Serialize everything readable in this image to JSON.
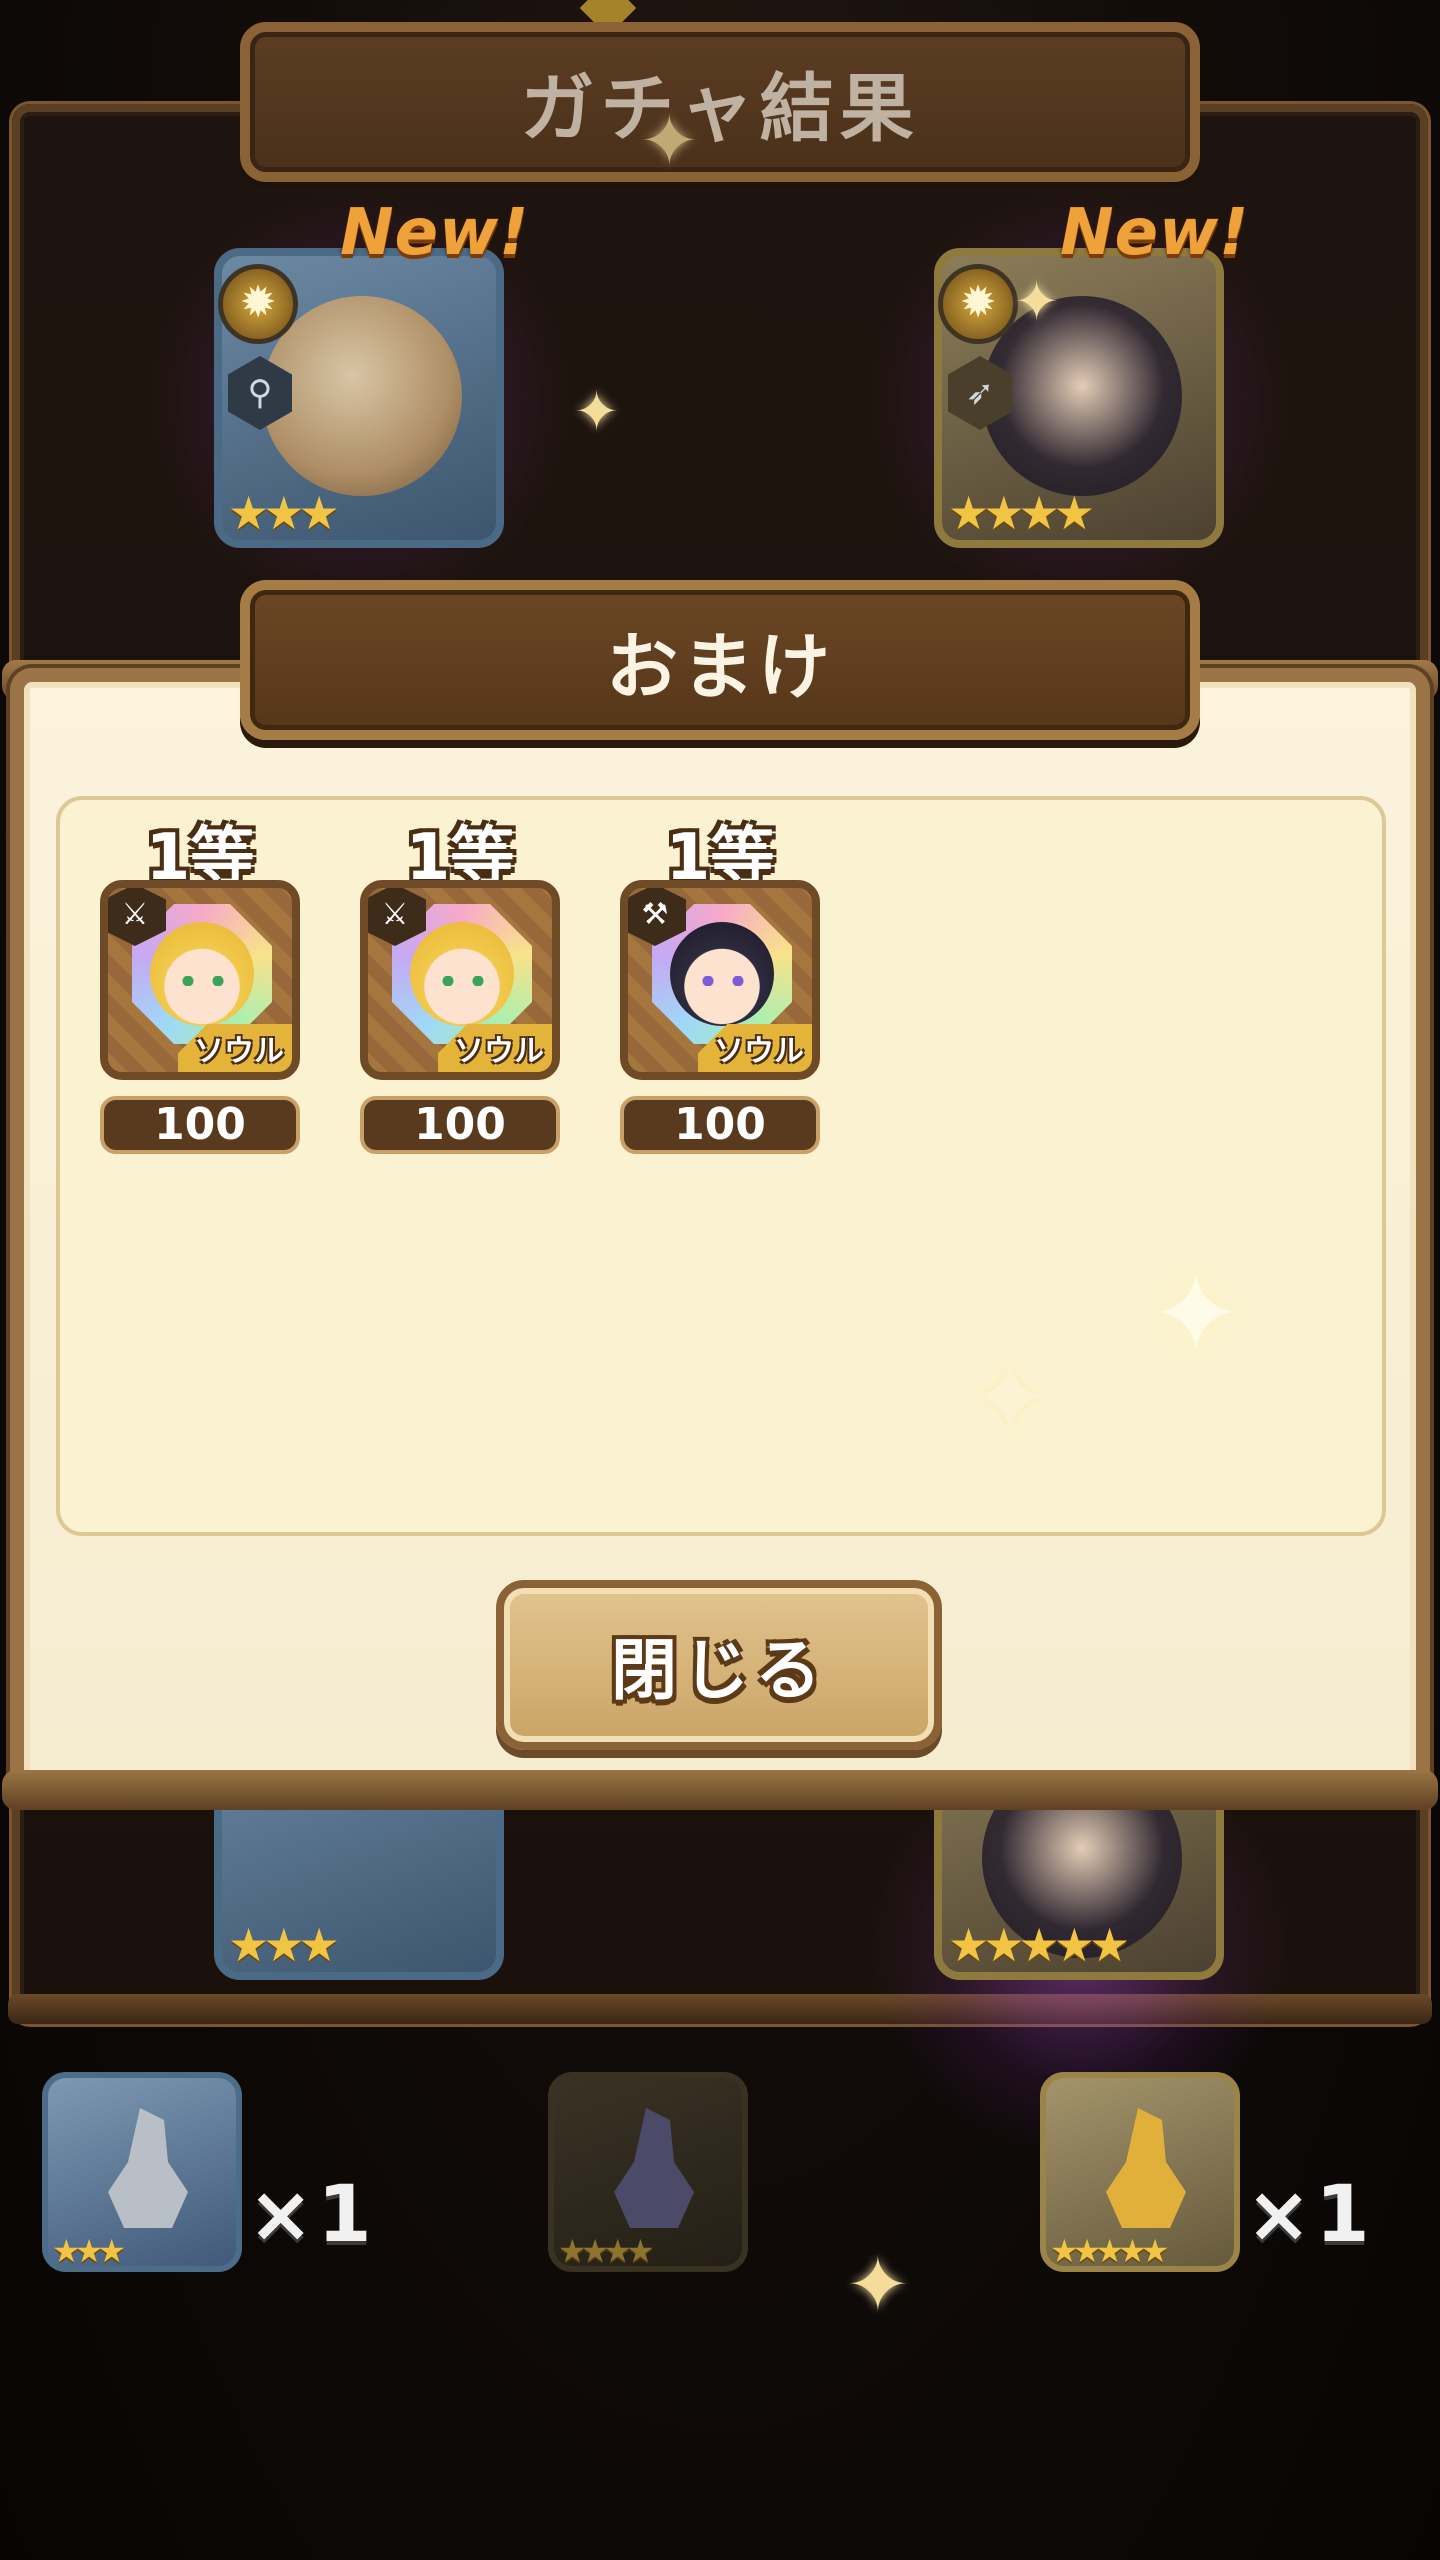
{
  "header": {
    "title": "ガチャ結果"
  },
  "gacha_results": [
    {
      "new_label": "New!",
      "stars": "★★★",
      "rarity": 3,
      "weapon_icon": "staff-icon",
      "emblem_icon": "sun-icon"
    },
    {
      "new_label": "New!",
      "stars": "★★★★",
      "rarity": 4,
      "weapon_icon": "bow-icon",
      "emblem_icon": "sun-icon"
    },
    {
      "stars": "★★★",
      "rarity": 3
    },
    {
      "stars": "★★★★★",
      "rarity": 5
    }
  ],
  "bonus_modal": {
    "title": "おまけ",
    "rewards": [
      {
        "rank": "1等",
        "type_label": "ソウル",
        "quantity": "100",
        "type_icon": "sword-icon"
      },
      {
        "rank": "1等",
        "type_label": "ソウル",
        "quantity": "100",
        "type_icon": "sword-icon"
      },
      {
        "rank": "1等",
        "type_label": "ソウル",
        "quantity": "100",
        "type_icon": "hammer-icon"
      }
    ],
    "close_label": "閉じる"
  },
  "statues": [
    {
      "stars": "★★★",
      "rarity": 3,
      "count": "×1"
    },
    {
      "stars": "★★★★",
      "rarity": 4,
      "count": ""
    },
    {
      "stars": "★★★★★",
      "rarity": 5,
      "count": "×1"
    }
  ],
  "colors": {
    "frame": "#9a7446",
    "panel": "#fbf2d1",
    "accent_new": "#f0a23a",
    "glow": "#ad4dd6"
  }
}
